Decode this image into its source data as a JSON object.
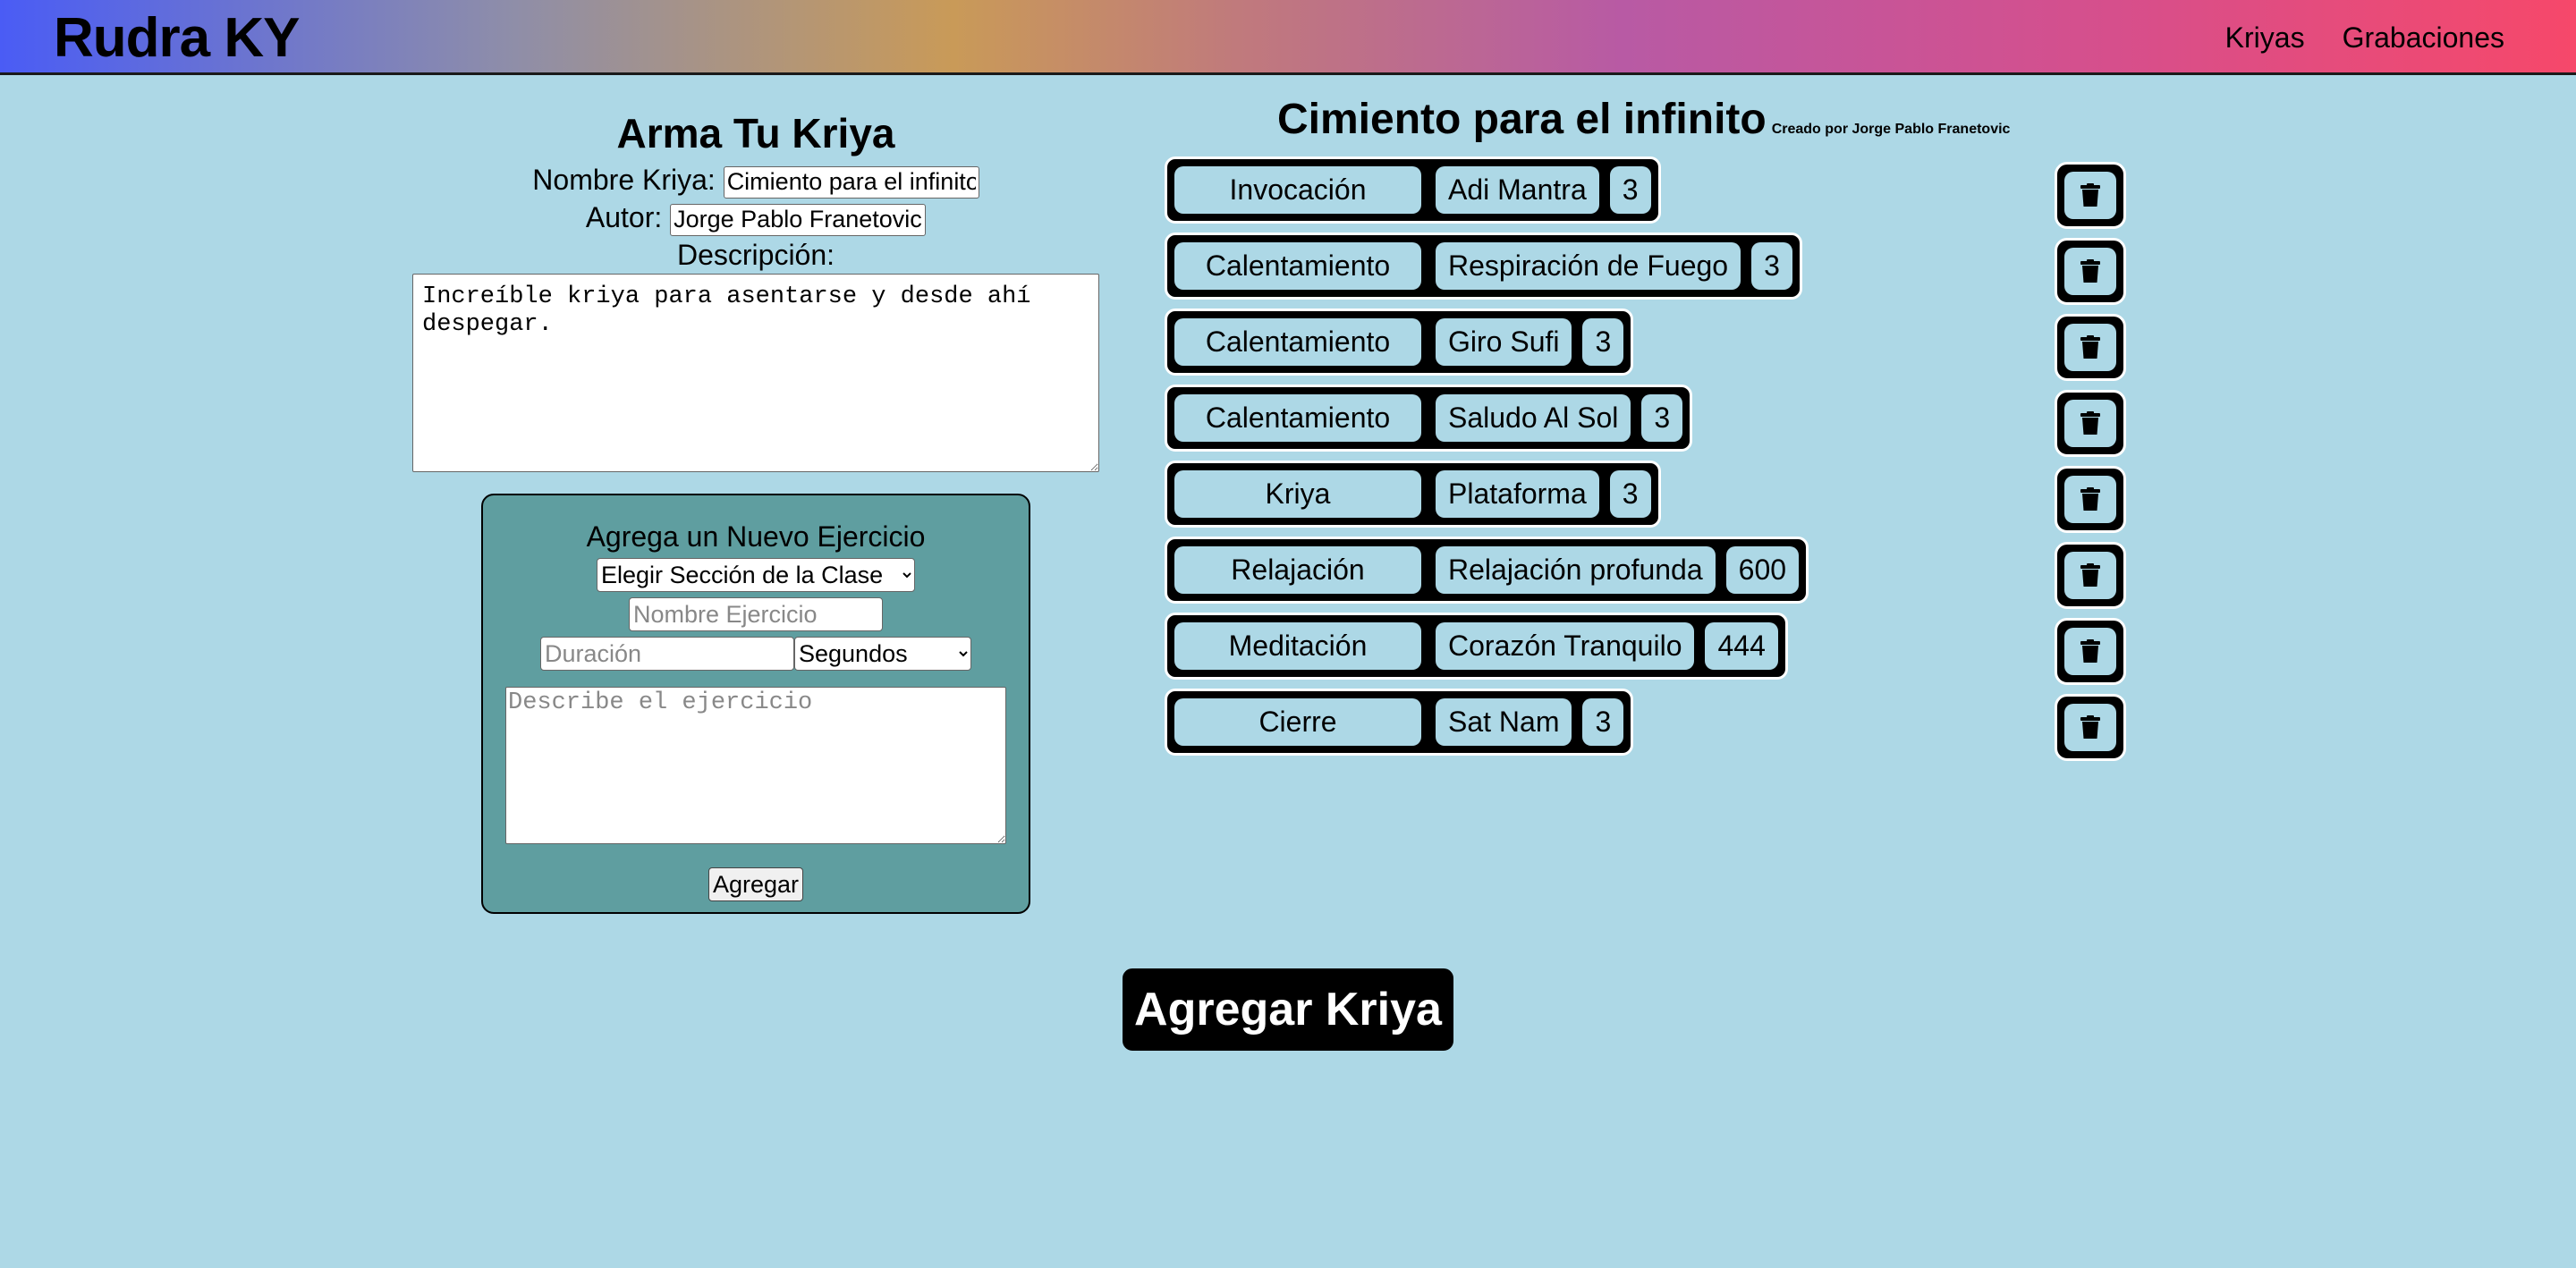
{
  "header": {
    "brand": "Rudra KY",
    "nav": [
      "Kriyas",
      "Grabaciones"
    ],
    "gradient_colors": [
      "#4a5cf5",
      "#c99a58",
      "#b85aa4",
      "#f6486a"
    ]
  },
  "form": {
    "title": "Arma Tu Kriya",
    "name_label": "Nombre Kriya:",
    "name_value": "Cimiento para el infinito",
    "author_label": "Autor:",
    "author_value": "Jorge Pablo Franetovic",
    "description_label": "Descripción:",
    "description_value": "Increíble kriya para asentarse y desde ahí despegar."
  },
  "new_exercise": {
    "title": "Agrega un Nuevo Ejercicio",
    "section_select": "Elegir Sección de la Clase",
    "name_placeholder": "Nombre Ejercicio",
    "duration_placeholder": "Duración",
    "unit_select": "Segundos",
    "description_placeholder": "Describe el ejercicio",
    "add_button": "Agregar"
  },
  "kriya": {
    "title": "Cimiento para el infinito",
    "author": "Creado por Jorge Pablo Franetovic",
    "exercises": [
      {
        "section": "Invocación",
        "name": "Adi Mantra",
        "duration": "3"
      },
      {
        "section": "Calentamiento",
        "name": "Respiración de Fuego",
        "duration": "3"
      },
      {
        "section": "Calentamiento",
        "name": "Giro Sufi",
        "duration": "3"
      },
      {
        "section": "Calentamiento",
        "name": "Saludo Al Sol",
        "duration": "3"
      },
      {
        "section": "Kriya",
        "name": "Plataforma",
        "duration": "3"
      },
      {
        "section": "Relajación",
        "name": "Relajación profunda",
        "duration": "600"
      },
      {
        "section": "Meditación",
        "name": "Corazón Tranquilo",
        "duration": "444"
      },
      {
        "section": "Cierre",
        "name": "Sat Nam",
        "duration": "3"
      }
    ],
    "delete_icon": "trash-icon"
  },
  "submit_button": "Agregar Kriya",
  "colors": {
    "background": "#add8e6",
    "panel": "#5f9ea0",
    "row": "#000000",
    "chip": "#add8e6"
  }
}
